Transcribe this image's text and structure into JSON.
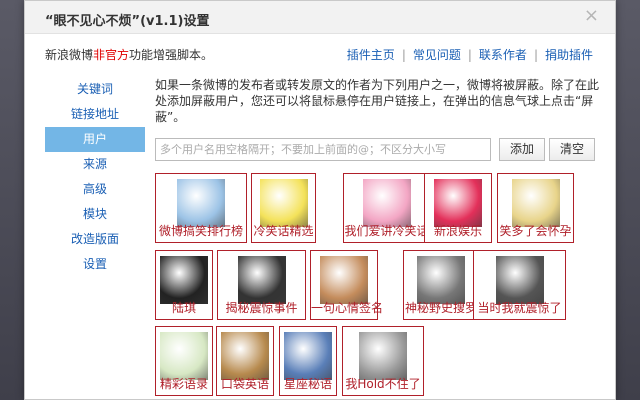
{
  "dialog": {
    "title": "“眼不见心不烦”(v1.1)设置",
    "close_glyph": "×"
  },
  "intro": {
    "part1": "新浪微博",
    "part2": "非官方",
    "part3": "功能增强脚本。"
  },
  "links": [
    "插件主页",
    "常见问题",
    "联系作者",
    "捐助插件"
  ],
  "sidebar": {
    "items": [
      {
        "label": "关键词"
      },
      {
        "label": "链接地址"
      },
      {
        "label": "用户",
        "active": true
      },
      {
        "label": "来源"
      },
      {
        "label": "高级"
      },
      {
        "label": "模块"
      },
      {
        "label": "改造版面"
      },
      {
        "label": "设置"
      }
    ]
  },
  "description": "如果一条微博的发布者或转发原文的作者为下列用户之一，微博将被屏蔽。除了在此处添加屏蔽用户，您还可以将鼠标悬停在用户链接上，在弹出的信息气球上点击“屏蔽”。",
  "search": {
    "placeholder": "多个用户名用空格隔开；不要加上前面的@；不区分大小写"
  },
  "buttons": {
    "add": "添加",
    "clear": "清空"
  },
  "users": [
    {
      "name": "微博搞笑排行榜",
      "icon": "cartoon-avatar-icon",
      "color": "#9cc3e6"
    },
    {
      "name": "冷笑话精选",
      "icon": "yellow-rabbit-icon",
      "color": "#f4e25a"
    },
    {
      "name": "我们爱讲冷笑话",
      "icon": "pink-rabbit-icon",
      "color": "#f3a6c4"
    },
    {
      "name": "新浪娱乐",
      "icon": "sina-eye-logo-icon",
      "color": "#e3305a"
    },
    {
      "name": "笑多了会怀孕",
      "icon": "comic-panel-icon",
      "color": "#e8d48a"
    },
    {
      "name": "陆琪",
      "icon": "portrait-photo-icon",
      "color": "#222222"
    },
    {
      "name": "揭秘震惊事件",
      "icon": "shock-text-icon",
      "color": "#333333"
    },
    {
      "name": "一句心情签名",
      "icon": "girl-flower-icon",
      "color": "#c48c5c"
    },
    {
      "name": "神秘野史搜罗",
      "icon": "skeleton-figure-icon",
      "color": "#777777"
    },
    {
      "name": "当时我就震惊了",
      "icon": "sunglasses-face-icon",
      "color": "#555555"
    },
    {
      "name": "精彩语录",
      "icon": "text-logo-icon",
      "color": "#d7e8c4"
    },
    {
      "name": "口袋英语",
      "icon": "landscape-photo-icon",
      "color": "#b78a4e"
    },
    {
      "name": "星座秘语",
      "icon": "starry-girl-icon",
      "color": "#5a7fb8"
    },
    {
      "name": "我Hold不住了",
      "icon": "cat-face-icon",
      "color": "#9a9a9a"
    }
  ]
}
